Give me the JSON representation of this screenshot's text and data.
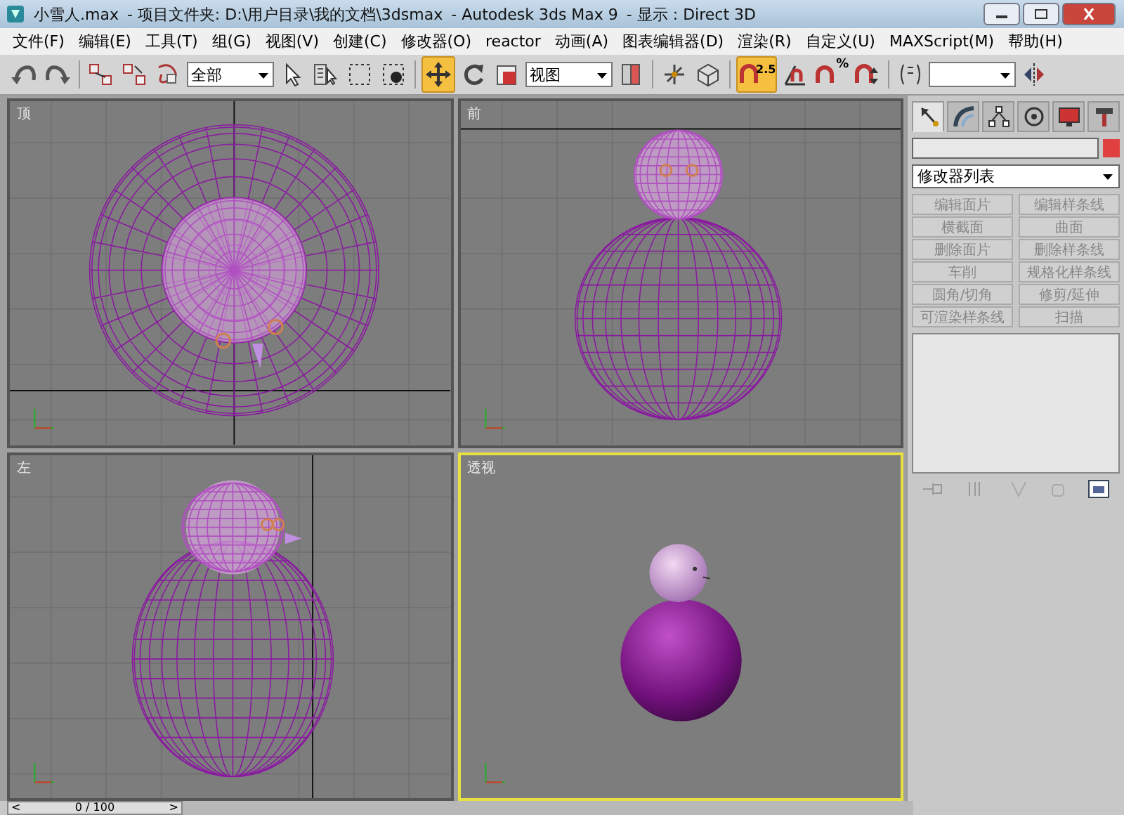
{
  "window": {
    "title_parts": [
      "小雪人.max",
      "- 项目文件夹: D:\\用户目录\\我的文档\\3dsmax",
      "- Autodesk 3ds Max 9",
      "- 显示 : Direct 3D"
    ]
  },
  "menu": [
    "文件(F)",
    "编辑(E)",
    "工具(T)",
    "组(G)",
    "视图(V)",
    "创建(C)",
    "修改器(O)",
    "reactor",
    "动画(A)",
    "图表编辑器(D)",
    "渲染(R)",
    "自定义(U)",
    "MAXScript(M)",
    "帮助(H)"
  ],
  "toolbar": [
    {
      "kind": "undo",
      "selected": false
    },
    {
      "kind": "redo",
      "selected": false
    },
    {
      "kind": "sep"
    },
    {
      "kind": "link",
      "selected": false
    },
    {
      "kind": "unlink",
      "selected": false
    },
    {
      "kind": "bind",
      "selected": false
    },
    {
      "kind": "dropdown",
      "text": "全部"
    },
    {
      "kind": "pointer",
      "selected": false
    },
    {
      "kind": "select-list",
      "selected": false
    },
    {
      "kind": "rect",
      "selected": false
    },
    {
      "kind": "crossing",
      "selected": false
    },
    {
      "kind": "sep"
    },
    {
      "kind": "move",
      "selected": true
    },
    {
      "kind": "rotate",
      "selected": false
    },
    {
      "kind": "scale",
      "selected": false
    },
    {
      "kind": "dropdown",
      "text": "视图"
    },
    {
      "kind": "pivot",
      "selected": false
    },
    {
      "kind": "sep"
    },
    {
      "kind": "manipulate",
      "selected": false
    },
    {
      "kind": "keyboard",
      "selected": false
    },
    {
      "kind": "sep"
    },
    {
      "kind": "snap",
      "text": "2.5",
      "selected": true
    },
    {
      "kind": "angle",
      "selected": false
    },
    {
      "kind": "percent",
      "text": "%",
      "selected": false
    },
    {
      "kind": "spinner",
      "selected": false
    },
    {
      "kind": "sep"
    },
    {
      "kind": "named",
      "selected": false
    },
    {
      "kind": "dropdown"
    },
    {
      "kind": "mirror",
      "selected": false
    }
  ],
  "viewports": [
    {
      "label": "顶",
      "kind": "top",
      "selected": false
    },
    {
      "label": "前",
      "kind": "front",
      "selected": false
    },
    {
      "label": "左",
      "kind": "left",
      "selected": false
    },
    {
      "label": "透视",
      "kind": "perspective",
      "selected": true
    }
  ],
  "command_panel": {
    "tabs": [
      {
        "kind": "create",
        "selected": true
      },
      {
        "kind": "modify",
        "selected": false
      },
      {
        "kind": "hierarchy",
        "selected": false
      },
      {
        "kind": "motion",
        "selected": false
      },
      {
        "kind": "display",
        "selected": false
      },
      {
        "kind": "utilities",
        "selected": false
      }
    ],
    "object": {
      "color": "#e04040"
    },
    "modifier_list": "修改器列表",
    "buttons": [
      "编辑面片",
      "编辑样条线",
      "横截面",
      "曲面",
      "删除面片",
      "删除样条线",
      "车削",
      "规格化样条线",
      "圆角/切角",
      "修剪/延伸",
      "可渲染样条线",
      "扫描"
    ]
  },
  "time_slider": {
    "position": "0 / 100",
    "prev": "<",
    "next": ">",
    "level": 0
  }
}
